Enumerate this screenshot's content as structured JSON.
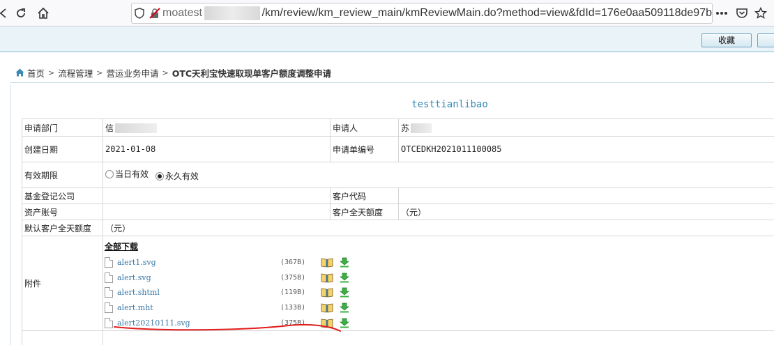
{
  "browser": {
    "url_host": "moatest",
    "url_path": "/km/review/km_review_main/kmReviewMain.do?method=view&fdId=176e0aa509118de97b",
    "icons": [
      "back-icon",
      "reload-icon",
      "home-icon",
      "shield-icon",
      "insecure-lock-icon",
      "more-icon",
      "pocket-icon",
      "bookmark-star-icon"
    ]
  },
  "toolbar": {
    "favorite_label": "收藏"
  },
  "breadcrumb": {
    "home": "首页",
    "items": [
      "流程管理",
      "营运业务申请"
    ],
    "current": "OTC天利宝快速取现单客户额度调整申请"
  },
  "document": {
    "title": "testtianlibao",
    "fields": {
      "dept_label": "申请部门",
      "dept_value": "信",
      "applicant_label": "申请人",
      "applicant_value": "苏",
      "created_label": "创建日期",
      "created_value": "2021-01-08",
      "number_label": "申请单编号",
      "number_value": "OTCEDKH2021011100085",
      "validity_label": "有效期限",
      "validity_opt1": "当日有效",
      "validity_opt2": "永久有效",
      "validity_selected": "永久有效",
      "fund_label": "基金登记公司",
      "fund_value": "",
      "client_code_label": "客户代码",
      "client_code_value": "",
      "account_label": "资产账号",
      "account_value": "",
      "client_limit_label": "客户全天额度",
      "client_limit_value": "（元）",
      "default_limit_label": "默认客户全天额度",
      "default_limit_value": "（元）",
      "attachments_label": "附件"
    },
    "download_all": "全部下载",
    "attachments": [
      {
        "name": "alert1.svg",
        "size": "(367B)"
      },
      {
        "name": "alert.svg",
        "size": "(375B)"
      },
      {
        "name": "alert.shtml",
        "size": "(119B)"
      },
      {
        "name": "alert.mht",
        "size": "(133B)"
      },
      {
        "name": "alert20210111.svg",
        "size": "(375B)"
      }
    ],
    "highlight_color": "#e21c1c"
  }
}
